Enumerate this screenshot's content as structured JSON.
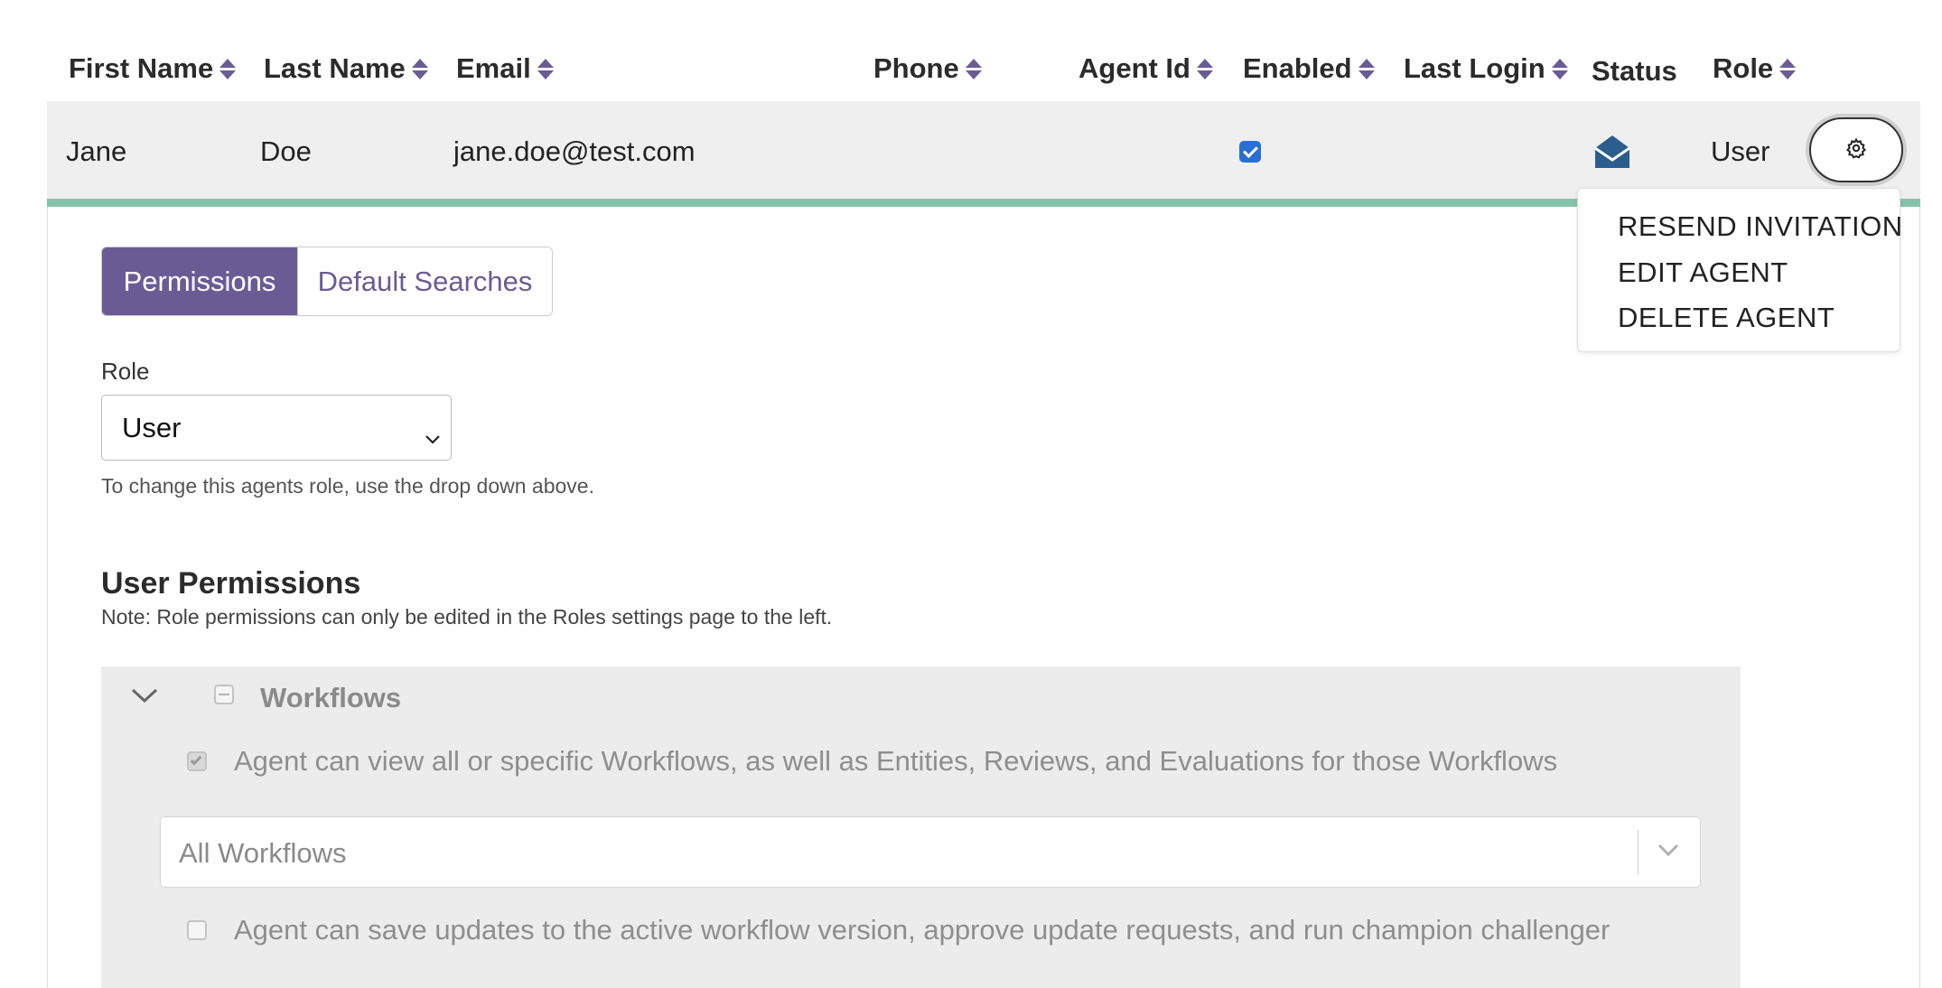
{
  "table": {
    "headers": {
      "first_name": "First Name",
      "last_name": "Last Name",
      "email": "Email",
      "phone": "Phone",
      "agent_id": "Agent Id",
      "enabled": "Enabled",
      "last_login": "Last Login",
      "status": "Status",
      "role": "Role"
    },
    "row": {
      "first_name": "Jane",
      "last_name": "Doe",
      "email": "jane.doe@test.com",
      "phone": "",
      "agent_id": "",
      "enabled": true,
      "last_login": "",
      "status_icon": "envelope-open-icon",
      "role": "User"
    }
  },
  "actions_menu": {
    "items": [
      "RESEND INVITATION",
      "EDIT AGENT",
      "DELETE AGENT"
    ]
  },
  "details": {
    "tabs": [
      {
        "label": "Permissions",
        "active": true
      },
      {
        "label": "Default Searches",
        "active": false
      }
    ],
    "role_label": "Role",
    "role_value": "User",
    "role_hint": "To change this agents role, use the drop down above.",
    "permissions_title": "User Permissions",
    "permissions_note": "Note: Role permissions can only be edited in the Roles settings page to the left.",
    "workflows": {
      "title": "Workflows",
      "items": [
        {
          "text": "Agent can view all or specific Workflows, as well as Entities, Reviews, and Evaluations for those Workflows",
          "checked": true
        },
        {
          "text": "Agent can save updates to the active workflow version, approve update requests, and run champion challenger",
          "checked": false
        }
      ],
      "select_value": "All Workflows"
    }
  },
  "colors": {
    "accent": "#6b5b95",
    "row_highlight": "#86c3ad",
    "checkbox": "#2a6fd6",
    "status_icon": "#2c5d8f"
  }
}
